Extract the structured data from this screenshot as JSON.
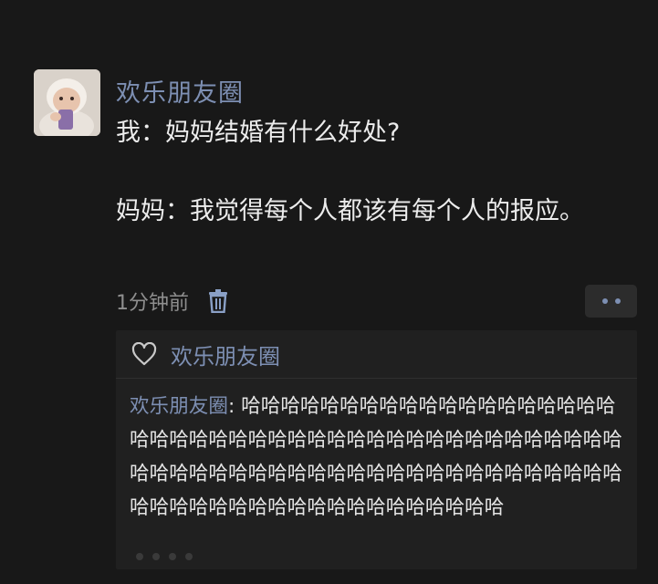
{
  "post": {
    "author": "欢乐朋友圈",
    "line1": "我：妈妈结婚有什么好处?",
    "line2": "妈妈：我觉得每个人都该有每个人的报应。",
    "time": "1分钟前"
  },
  "likes": {
    "names": "欢乐朋友圈"
  },
  "comment": {
    "author": "欢乐朋友圈",
    "separator": ": ",
    "text": "哈哈哈哈哈哈哈哈哈哈哈哈哈哈哈哈哈哈哈哈哈哈哈哈哈哈哈哈哈哈哈哈哈哈哈哈哈哈哈哈哈哈哈哈哈哈哈哈哈哈哈哈哈哈哈哈哈哈哈哈哈哈哈哈哈哈哈哈哈哈哈哈哈哈哈哈哈哈哈哈哈哈哈哈哈哈哈哈"
  },
  "colors": {
    "background": "#181818",
    "name_blue": "#7d8fb3",
    "panel": "#202020"
  },
  "icons": {
    "delete": "trash-icon",
    "like": "heart-icon",
    "more": "more-dots-icon"
  }
}
